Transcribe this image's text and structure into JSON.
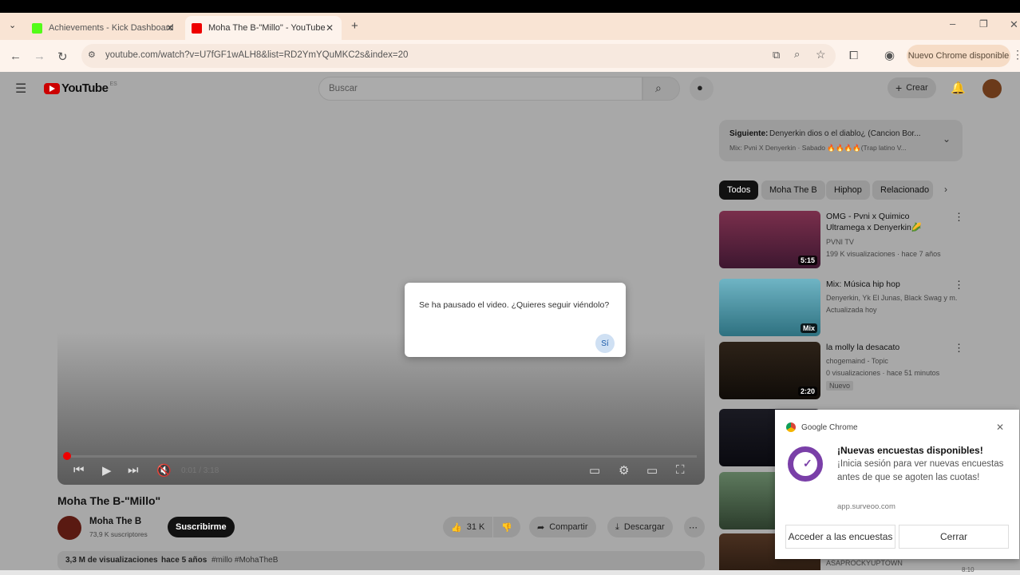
{
  "browser": {
    "tabs": [
      {
        "label": "Achievements - Kick Dashboard",
        "favicon": "kick-icon",
        "active": false
      },
      {
        "label": "Moha The B-\"Millo\" - YouTube",
        "favicon": "youtube-icon",
        "active": true
      }
    ],
    "url": "youtube.com/watch?v=U7fGF1wALH8&list=RD2YmYQuMKC2s&index=20",
    "update_button": "Nuevo Chrome disponible"
  },
  "youtube": {
    "logo_text": "YouTube",
    "logo_sup": "ES",
    "search_placeholder": "Buscar",
    "create_label": "Crear",
    "player": {
      "time": "0:01 / 3:18",
      "progress": 0.003
    },
    "pause_dialog": {
      "message": "Se ha pausado el video. ¿Quieres seguir viéndolo?",
      "confirm": "Sí"
    },
    "video": {
      "title": "Moha The B-\"Millo\"",
      "channel": "Moha The B",
      "subscribers": "73,9 K suscriptores",
      "subscribe": "Suscribirme",
      "likes": "31 K",
      "share": "Compartir",
      "download": "Descargar",
      "views": "3,3 M de visualizaciones",
      "age": "hace 5 años",
      "tags": "#millo #MohaTheB"
    },
    "up_next": {
      "label": "Siguiente:",
      "title": "Denyerkin dios o el diablo¿ (Cancion Bor...",
      "meta": "Mix: Pvni X Denyerkin · Sabado 🔥🔥🔥🔥(Trap latino V..."
    },
    "chips": [
      "Todos",
      "Moha The B",
      "Hiphop",
      "Relacionado"
    ],
    "recommendations": [
      {
        "title": "OMG - Pvni x Quimico Ultramega x Denyerkin🌽 (Tra...",
        "channel": "PVNI TV",
        "meta": "199 K visualizaciones · hace 7 años",
        "duration": "5:15"
      },
      {
        "title": "Mix: Música hip hop",
        "channel": "Denyerkin, Yk El Junas, Black Swag y m...",
        "meta": "Actualizada hoy",
        "duration": "Mix"
      },
      {
        "title": "la molly la desacato",
        "channel": "chogemaind - Topic",
        "meta": "0 visualizaciones · hace 51 minutos",
        "badge": "Nuevo",
        "duration": "2:20"
      },
      {
        "title": "",
        "channel": "ASAPROCKYUPTOWN",
        "meta": "",
        "duration": ""
      }
    ]
  },
  "notification": {
    "app": "Google Chrome",
    "title": "¡Nuevas encuestas disponibles!",
    "body": "¡Inicia sesión para ver nuevas encuestas antes de que se agoten las cuotas!",
    "site": "app.surveoo.com",
    "primary": "Acceder a las encuestas",
    "secondary": "Cerrar"
  },
  "taskbar_time": "8:10"
}
